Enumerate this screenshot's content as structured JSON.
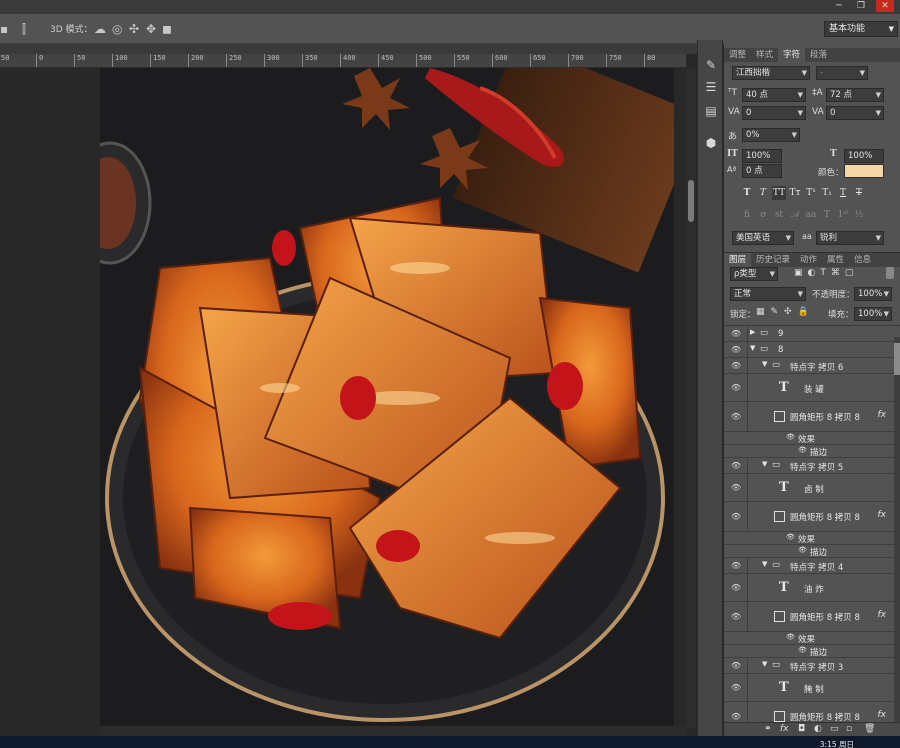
{
  "options_bar": {
    "mode_label": "3D 模式：",
    "workspace": "基本功能"
  },
  "ruler": {
    "ticks": [
      "50",
      "0",
      "50",
      "100",
      "150",
      "200",
      "250",
      "300",
      "350",
      "400",
      "450",
      "500",
      "550",
      "600",
      "650",
      "700",
      "750",
      "80"
    ]
  },
  "char_panel": {
    "tabs": [
      "调整",
      "样式",
      "字符",
      "段落"
    ],
    "active_tab": "字符",
    "font_family": "江西拙楷",
    "font_style": "-",
    "font_size": "40 点",
    "leading": "72 点",
    "kerning": "0",
    "tracking": "0",
    "scale_pct": "0%",
    "vertical_scale": "100%",
    "horizontal_scale": "100%",
    "baseline": "0 点",
    "color_label": "颜色：",
    "color_value": "#f7d6a6",
    "language": "美国英语",
    "aa_label": "aa",
    "antialias": "锐利"
  },
  "layers_panel": {
    "tabs": [
      "图层",
      "历史记录",
      "动作",
      "属性",
      "信息"
    ],
    "active_tab": "图层",
    "filter_label": "ρ类型",
    "blend_mode": "正常",
    "opacity_label": "不透明度：",
    "opacity": "100%",
    "lock_label": "锁定：",
    "fill_label": "填充：",
    "fill": "100%",
    "rows": [
      {
        "kind": "group",
        "name": "9",
        "indent": 0,
        "open": false
      },
      {
        "kind": "group",
        "name": "8",
        "indent": 0,
        "open": true
      },
      {
        "kind": "group",
        "name": "特点字 拷贝 6",
        "indent": 1,
        "open": true
      },
      {
        "kind": "text",
        "name": "装 罐"
      },
      {
        "kind": "shape",
        "name": "圆角矩形 8 拷贝 8",
        "fx": "fx"
      },
      {
        "kind": "effect",
        "name": "效果"
      },
      {
        "kind": "effect2",
        "name": "描边"
      },
      {
        "kind": "group",
        "name": "特点字 拷贝 5",
        "indent": 1,
        "open": true
      },
      {
        "kind": "text",
        "name": "卤 制"
      },
      {
        "kind": "shape",
        "name": "圆角矩形 8 拷贝 8",
        "fx": "fx"
      },
      {
        "kind": "effect",
        "name": "效果"
      },
      {
        "kind": "effect2",
        "name": "描边"
      },
      {
        "kind": "group",
        "name": "特点字 拷贝 4",
        "indent": 1,
        "open": true
      },
      {
        "kind": "text",
        "name": "油 炸"
      },
      {
        "kind": "shape",
        "name": "圆角矩形 8 拷贝 8",
        "fx": "fx"
      },
      {
        "kind": "effect",
        "name": "效果"
      },
      {
        "kind": "effect2",
        "name": "描边"
      },
      {
        "kind": "group",
        "name": "特点字 拷贝 3",
        "indent": 1,
        "open": true
      },
      {
        "kind": "text",
        "name": "腌 制"
      },
      {
        "kind": "shape",
        "name": "圆角矩形 8 拷贝 8",
        "fx": "fx"
      }
    ],
    "footer_icons": [
      "link-icon",
      "fx-icon",
      "mask-icon",
      "adjustment-icon",
      "folder-icon",
      "new-layer-icon",
      "trash-icon"
    ]
  },
  "taskbar": {
    "time": "3:15 周日"
  }
}
